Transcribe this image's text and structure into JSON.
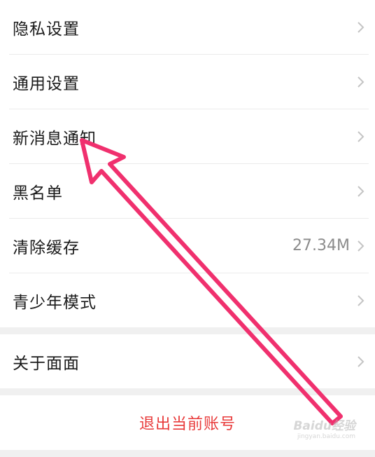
{
  "settings": {
    "group1": [
      {
        "label": "隐私设置",
        "value": ""
      },
      {
        "label": "通用设置",
        "value": ""
      },
      {
        "label": "新消息通知",
        "value": ""
      },
      {
        "label": "黑名单",
        "value": ""
      },
      {
        "label": "清除缓存",
        "value": "27.34M"
      },
      {
        "label": "青少年模式",
        "value": ""
      }
    ],
    "group2": [
      {
        "label": "关于面面",
        "value": ""
      }
    ],
    "logout_label": "退出当前账号"
  },
  "watermark": {
    "brand": "Baidu经验",
    "url": "jingyan.baidu.com"
  },
  "colors": {
    "logout_text": "#e83a3a",
    "arrow": "#f0306e",
    "background": "#f0f0f0"
  },
  "icons": {
    "row_chevron": "chevron-right-icon"
  }
}
